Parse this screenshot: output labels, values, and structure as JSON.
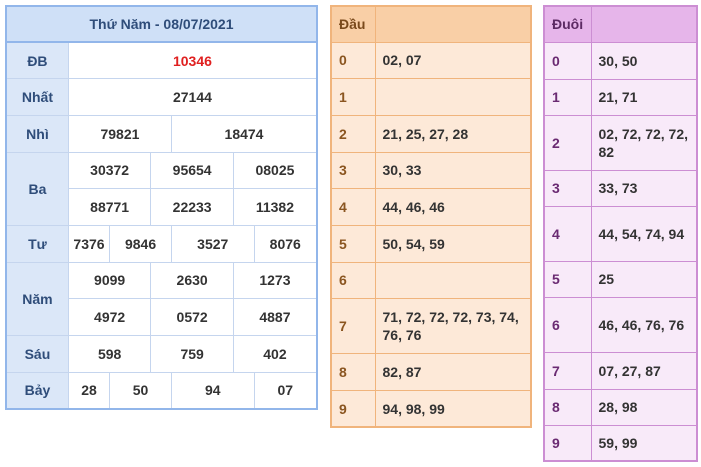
{
  "results": {
    "title": "Thứ Năm - 08/07/2021",
    "special_label": "ĐB",
    "special": "10346",
    "first_label": "Nhất",
    "first": "27144",
    "second_label": "Nhì",
    "second": [
      "79821",
      "18474"
    ],
    "third_label": "Ba",
    "third": [
      "30372",
      "95654",
      "08025",
      "88771",
      "22233",
      "11382"
    ],
    "fourth_label": "Tư",
    "fourth": [
      "7376",
      "9846",
      "3527",
      "8076"
    ],
    "fifth_label": "Năm",
    "fifth": [
      "9099",
      "2630",
      "1273",
      "4972",
      "0572",
      "4887"
    ],
    "sixth_label": "Sáu",
    "sixth": [
      "598",
      "759",
      "402"
    ],
    "seventh_label": "Bảy",
    "seventh": [
      "28",
      "50",
      "94",
      "07"
    ]
  },
  "head": {
    "header_key": "Đầu",
    "header_val": "",
    "rows": [
      {
        "k": "0",
        "v": "02, 07"
      },
      {
        "k": "1",
        "v": ""
      },
      {
        "k": "2",
        "v": "21, 25, 27, 28"
      },
      {
        "k": "3",
        "v": "30, 33"
      },
      {
        "k": "4",
        "v": "44, 46, 46"
      },
      {
        "k": "5",
        "v": "50, 54, 59"
      },
      {
        "k": "6",
        "v": ""
      },
      {
        "k": "7",
        "v": "71, 72, 72, 72, 73, 74, 76, 76"
      },
      {
        "k": "8",
        "v": "82, 87"
      },
      {
        "k": "9",
        "v": "94, 98, 99"
      }
    ]
  },
  "tail": {
    "header_key": "Đuôi",
    "header_val": "",
    "rows": [
      {
        "k": "0",
        "v": "30, 50"
      },
      {
        "k": "1",
        "v": "21, 71"
      },
      {
        "k": "2",
        "v": "02, 72, 72, 72, 82"
      },
      {
        "k": "3",
        "v": "33, 73"
      },
      {
        "k": "4",
        "v": "44, 54, 74, 94"
      },
      {
        "k": "5",
        "v": "25"
      },
      {
        "k": "6",
        "v": "46, 46, 76, 76"
      },
      {
        "k": "7",
        "v": "07, 27, 87"
      },
      {
        "k": "8",
        "v": "28, 98"
      },
      {
        "k": "9",
        "v": "59, 99"
      }
    ]
  },
  "colors": {
    "special_number": "#e02020",
    "results_accent": "#92b6ea",
    "head_accent": "#f0b47c",
    "tail_accent": "#cc8ed3"
  }
}
